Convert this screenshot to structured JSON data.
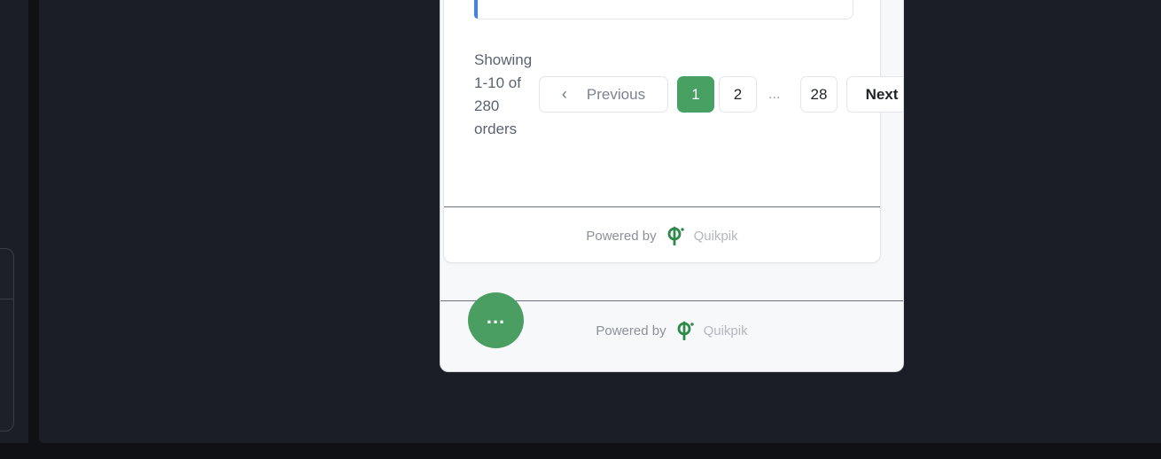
{
  "pagination": {
    "summary": "Showing 1-10 of 280 orders",
    "previous_label": "Previous",
    "next_label": "Next",
    "pages": [
      "1",
      "2",
      "28"
    ],
    "ellipsis": "...",
    "current_page": "1"
  },
  "footer_inner": {
    "powered_by": "Powered by",
    "brand": "Quikpik"
  },
  "footer_outer": {
    "powered_by": "Powered by",
    "brand": "Quikpik"
  },
  "fab": {
    "label": "..."
  },
  "colors": {
    "accent_green": "#48a063",
    "accent_blue": "#3b82f6",
    "dark_bg": "#1b1e26"
  },
  "icons": [
    "chevron-left-icon",
    "quikpik-logo-icon",
    "more-dots-icon"
  ]
}
